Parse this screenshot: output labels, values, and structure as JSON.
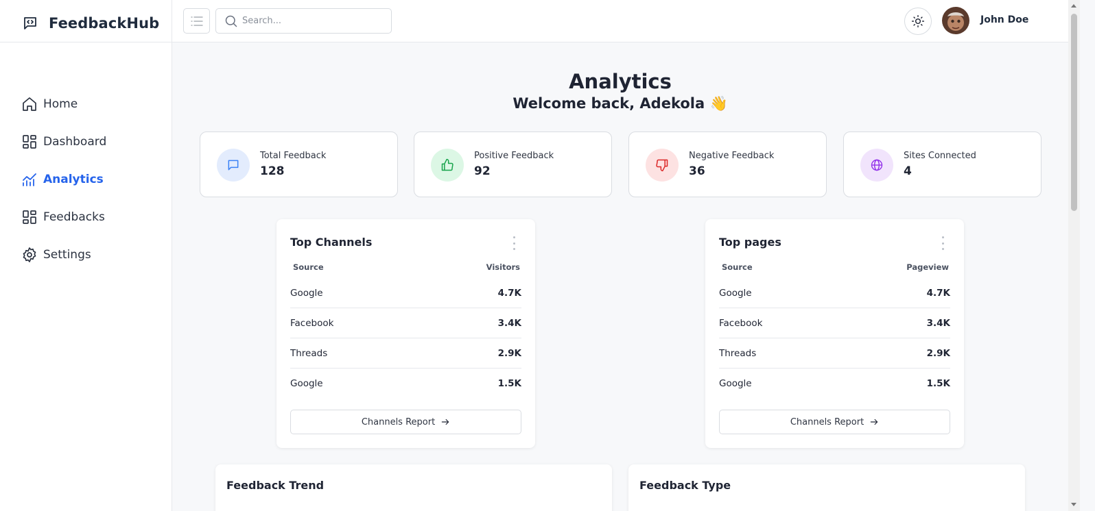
{
  "app": {
    "name": "FeedbackHub"
  },
  "nav": {
    "items": [
      {
        "label": "Home",
        "icon": "home-icon",
        "active": false
      },
      {
        "label": "Dashboard",
        "icon": "dashboard-icon",
        "active": false
      },
      {
        "label": "Analytics",
        "icon": "analytics-icon",
        "active": true
      },
      {
        "label": "Feedbacks",
        "icon": "feedbacks-icon",
        "active": false
      },
      {
        "label": "Settings",
        "icon": "settings-icon",
        "active": false
      }
    ]
  },
  "topbar": {
    "search_placeholder": "Search...",
    "user_name": "John Doe"
  },
  "page": {
    "title": "Analytics",
    "welcome": "Welcome back, Adekola 👋"
  },
  "stats": [
    {
      "label": "Total Feedback",
      "value": "128",
      "icon": "message-icon",
      "color": "#3b82f6",
      "bg": "#e3ecfd"
    },
    {
      "label": "Positive Feedback",
      "value": "92",
      "icon": "thumbs-up-icon",
      "color": "#16a34a",
      "bg": "#dcf7e5"
    },
    {
      "label": "Negative Feedback",
      "value": "36",
      "icon": "thumbs-down-icon",
      "color": "#dc2626",
      "bg": "#fde2e2"
    },
    {
      "label": "Sites Connected",
      "value": "4",
      "icon": "globe-icon",
      "color": "#9333ea",
      "bg": "#f1e4fc"
    }
  ],
  "top_channels": {
    "title": "Top Channels",
    "col_source": "Source",
    "col_value": "Visitors",
    "rows": [
      {
        "source": "Google",
        "value": "4.7K"
      },
      {
        "source": "Facebook",
        "value": "3.4K"
      },
      {
        "source": "Threads",
        "value": "2.9K"
      },
      {
        "source": "Google",
        "value": "1.5K"
      }
    ],
    "button": "Channels Report"
  },
  "top_pages": {
    "title": "Top pages",
    "col_source": "Source",
    "col_value": "Pageview",
    "rows": [
      {
        "source": "Google",
        "value": "4.7K"
      },
      {
        "source": "Facebook",
        "value": "3.4K"
      },
      {
        "source": "Threads",
        "value": "2.9K"
      },
      {
        "source": "Google",
        "value": "1.5K"
      }
    ],
    "button": "Channels Report"
  },
  "bottom_cards": {
    "trend_title": "Feedback Trend",
    "type_title": "Feedback Type"
  },
  "colors": {
    "accent": "#2563eb",
    "text": "#1f2433",
    "border": "#d9dce1"
  }
}
